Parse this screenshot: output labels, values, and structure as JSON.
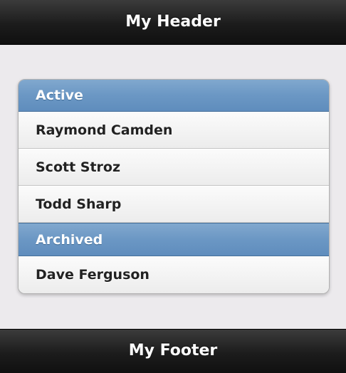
{
  "header": {
    "title": "My Header"
  },
  "footer": {
    "title": "My Footer"
  },
  "list": {
    "groups": [
      {
        "label": "Active",
        "items": [
          "Raymond Camden",
          "Scott Stroz",
          "Todd Sharp"
        ]
      },
      {
        "label": "Archived",
        "items": [
          "Dave Ferguson"
        ]
      }
    ]
  }
}
